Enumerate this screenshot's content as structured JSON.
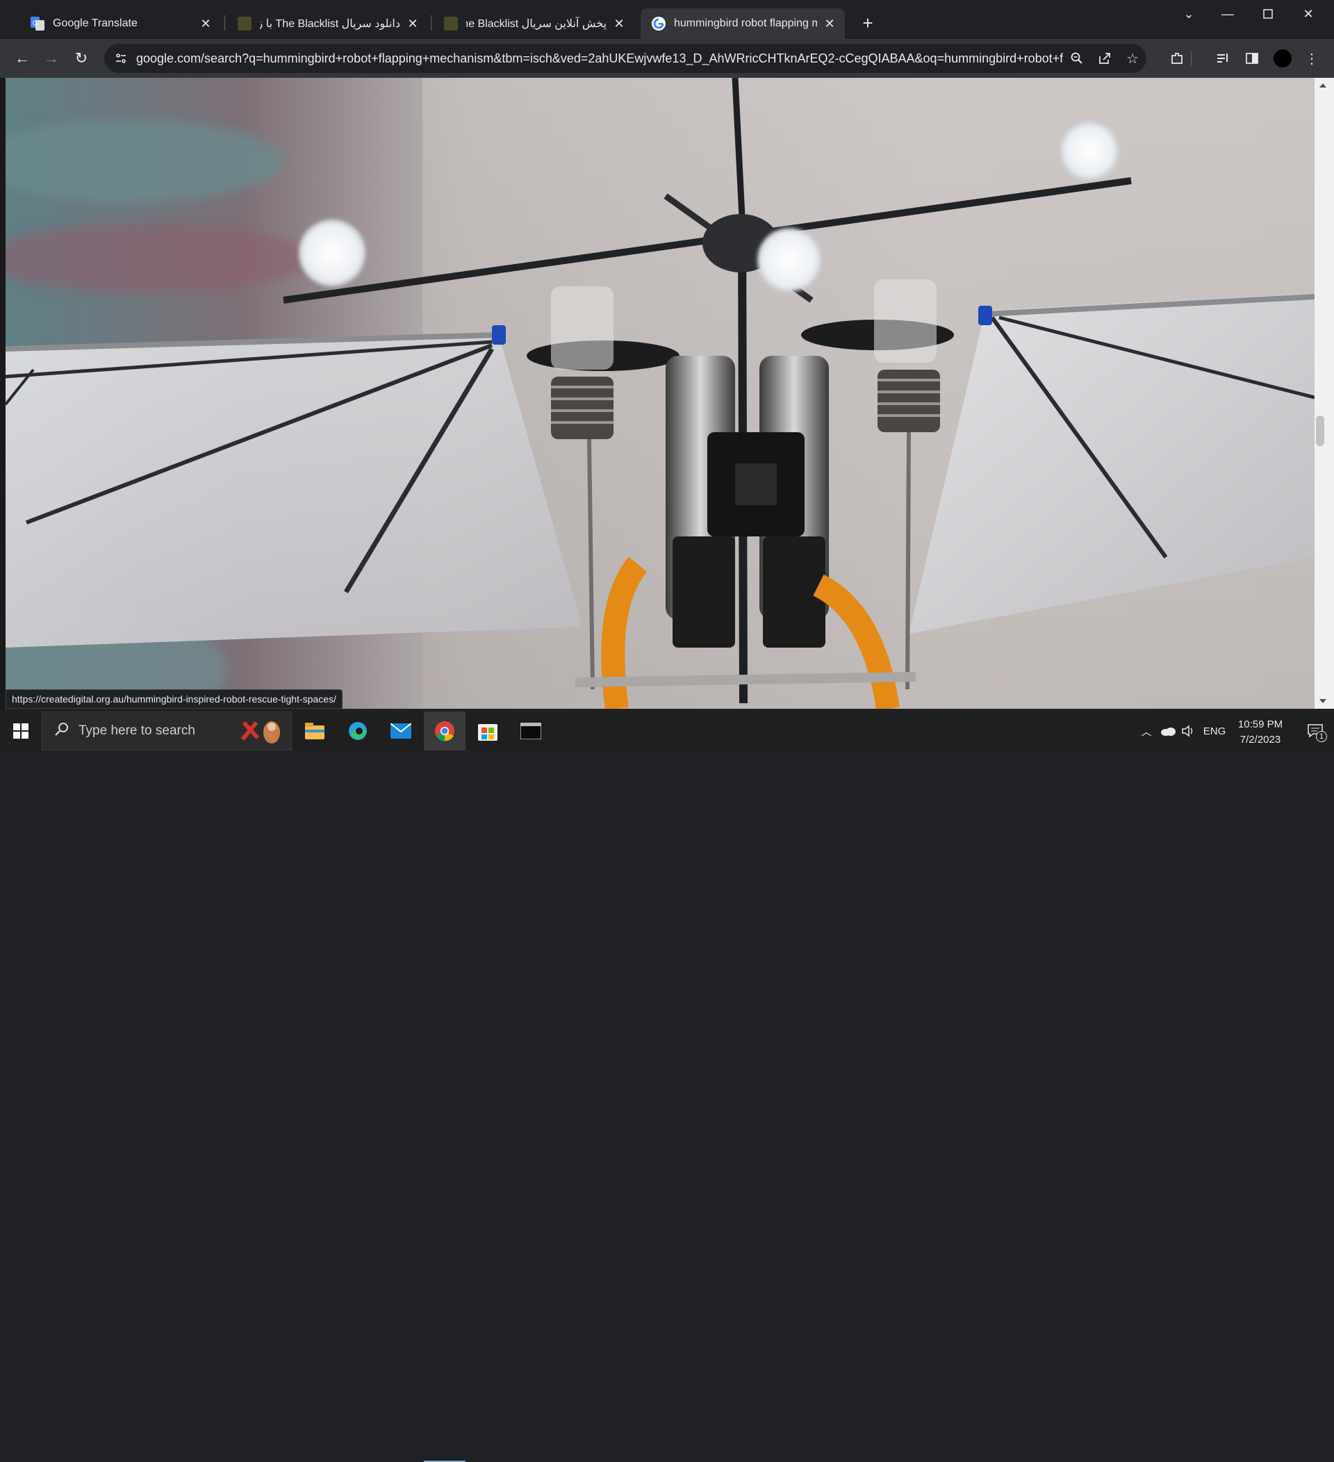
{
  "tabs": [
    {
      "title": "Google Translate",
      "active": false
    },
    {
      "title": "دانلود سریال The Blacklist با زیرن",
      "active": false
    },
    {
      "title": "پخش آنلاین سریال The Blacklist |",
      "active": false
    },
    {
      "title": "hummingbird robot flapping m",
      "active": true
    }
  ],
  "toolbar": {
    "url": "google.com/search?q=hummingbird+robot+flapping+mechanism&tbm=isch&ved=2ahUKEwjvwfe13_D_AhWRricCHTknArEQ2-cCegQIABAA&oq=hummingbird+robot+fla..."
  },
  "status": {
    "link": "https://createdigital.org.au/hummingbird-inspired-robot-rescue-tight-spaces/"
  },
  "taskbar": {
    "search_placeholder": "Type here to search",
    "language": "ENG",
    "time": "10:59 PM",
    "date": "7/2/2023",
    "notification_count": "1"
  },
  "colors": {
    "tab_bg": "#202124",
    "active_tab_bg": "#35363a",
    "taskbar_bg": "#1f1f1f"
  }
}
